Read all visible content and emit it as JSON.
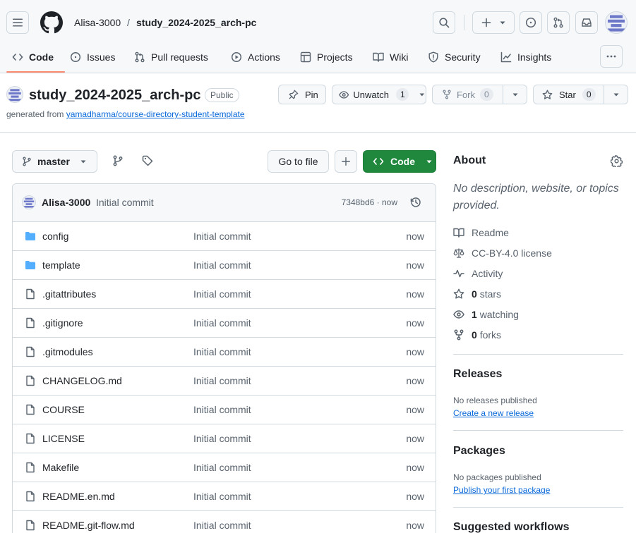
{
  "header": {
    "owner": "Alisa-3000",
    "separator": "/",
    "repo": "study_2024-2025_arch-pc"
  },
  "tabs": [
    {
      "label": "Code"
    },
    {
      "label": "Issues"
    },
    {
      "label": "Pull requests"
    },
    {
      "label": "Actions"
    },
    {
      "label": "Projects"
    },
    {
      "label": "Wiki"
    },
    {
      "label": "Security"
    },
    {
      "label": "Insights"
    }
  ],
  "repo": {
    "name": "study_2024-2025_arch-pc",
    "visibility": "Public",
    "generated_prefix": "generated from",
    "template_link": "yamadharma/course-directory-student-template",
    "pin_label": "Pin",
    "unwatch_label": "Unwatch",
    "unwatch_count": "1",
    "fork_label": "Fork",
    "fork_count": "0",
    "star_label": "Star",
    "star_count": "0"
  },
  "toolbar": {
    "branch": "master",
    "goto_file": "Go to file",
    "code_label": "Code"
  },
  "commit": {
    "author": "Alisa-3000",
    "message": "Initial commit",
    "meta": "7348bd6 · now"
  },
  "files": [
    {
      "name": "config",
      "type": "folder",
      "message": "Initial commit",
      "time": "now"
    },
    {
      "name": "template",
      "type": "folder",
      "message": "Initial commit",
      "time": "now"
    },
    {
      "name": ".gitattributes",
      "type": "file",
      "message": "Initial commit",
      "time": "now"
    },
    {
      "name": ".gitignore",
      "type": "file",
      "message": "Initial commit",
      "time": "now"
    },
    {
      "name": ".gitmodules",
      "type": "file",
      "message": "Initial commit",
      "time": "now"
    },
    {
      "name": "CHANGELOG.md",
      "type": "file",
      "message": "Initial commit",
      "time": "now"
    },
    {
      "name": "COURSE",
      "type": "file",
      "message": "Initial commit",
      "time": "now"
    },
    {
      "name": "LICENSE",
      "type": "file",
      "message": "Initial commit",
      "time": "now"
    },
    {
      "name": "Makefile",
      "type": "file",
      "message": "Initial commit",
      "time": "now"
    },
    {
      "name": "README.en.md",
      "type": "file",
      "message": "Initial commit",
      "time": "now"
    },
    {
      "name": "README.git-flow.md",
      "type": "file",
      "message": "Initial commit",
      "time": "now"
    }
  ],
  "about": {
    "title": "About",
    "description": "No description, website, or topics provided.",
    "readme": "Readme",
    "license": "CC-BY-4.0 license",
    "activity": "Activity",
    "stars_count": "0",
    "stars_label": "stars",
    "watching_count": "1",
    "watching_label": "watching",
    "forks_count": "0",
    "forks_label": "forks"
  },
  "releases": {
    "title": "Releases",
    "empty": "No releases published",
    "link": "Create a new release"
  },
  "packages": {
    "title": "Packages",
    "empty": "No packages published",
    "link": "Publish your first package"
  },
  "workflows": {
    "title": "Suggested workflows"
  },
  "colors": {
    "accent": "#0969da",
    "primary_button": "#1f883d",
    "tab_underline": "#fd8c73",
    "folder_icon": "#54aeff"
  }
}
